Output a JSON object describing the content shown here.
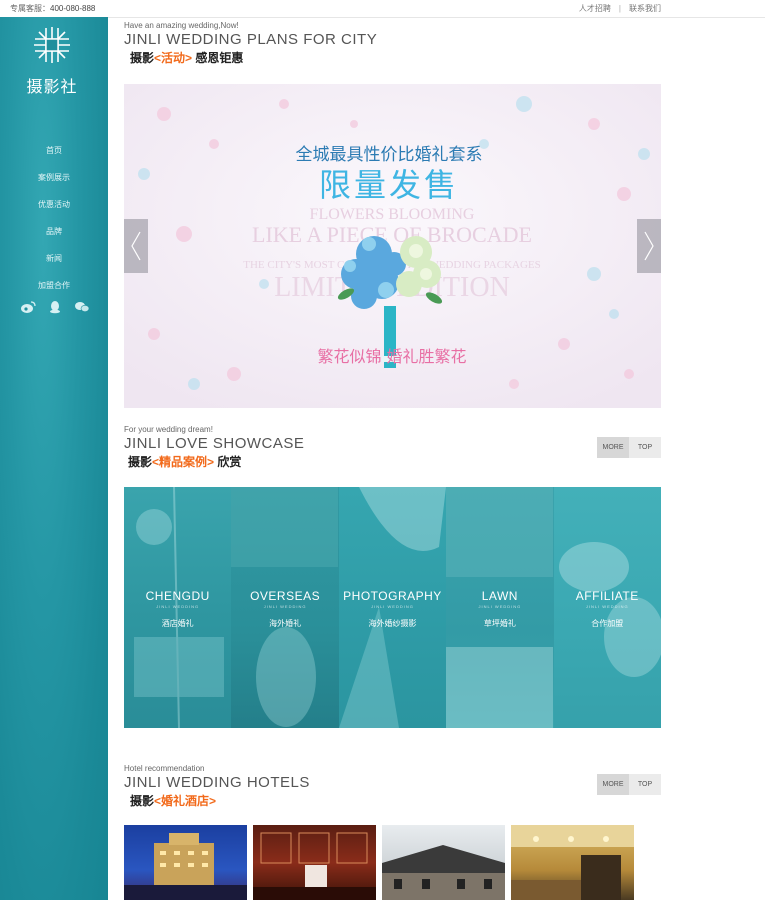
{
  "topbar": {
    "hotline_label": "专属客服：",
    "hotline_number": "400-080-888",
    "links": [
      "人才招聘",
      "联系我们"
    ]
  },
  "sidebar": {
    "logo_text": "摄影社",
    "nav": [
      "首页",
      "案例展示",
      "优惠活动",
      "品牌",
      "新闻",
      "加盟合作"
    ],
    "social_icons": [
      "weibo-icon",
      "qq-icon",
      "wechat-icon"
    ]
  },
  "section_plans": {
    "eyebrow": "Have an amazing wedding,Now!",
    "title": "JINLI WEDDING PLANS FOR CITY",
    "sub_prefix": "摄影",
    "sub_highlight": "<活动>",
    "sub_suffix": " 感恩钜惠"
  },
  "banner": {
    "headline": "全城最具性价比婚礼套系",
    "big": "限量发售",
    "en_line1": "FLOWERS BLOOMING",
    "en_line2": "LIKE A PIECE OF BROCADE",
    "en_line3": "THE CITY'S MOST COST-EFFECTIVE WEDDING PACKAGES",
    "en_line4": "LIMITED EDITION",
    "tagline": "繁花似锦 婚礼胜繁花"
  },
  "section_showcase": {
    "eyebrow": "For your wedding dream!",
    "title": "JINLI LOVE SHOWCASE",
    "sub_prefix": "摄影",
    "sub_highlight": "<精品案例>",
    "sub_suffix": " 欣赏",
    "more": "MORE",
    "top": "TOP",
    "cases": [
      {
        "name": "CHENGDU",
        "sub": "JINLI WEDDING",
        "cn": "酒店婚礼"
      },
      {
        "name": "OVERSEAS",
        "sub": "JINLI WEDDING",
        "cn": "海外婚礼"
      },
      {
        "name": "PHOTOGRAPHY",
        "sub": "JINLI WEDDING",
        "cn": "海外婚纱摄影"
      },
      {
        "name": "LAWN",
        "sub": "JINLI WEDDING",
        "cn": "草坪婚礼"
      },
      {
        "name": "AFFILIATE",
        "sub": "JINLI WEDDING",
        "cn": "合作加盟"
      }
    ]
  },
  "section_hotels": {
    "eyebrow": "Hotel recommendation",
    "title": "JINLI WEDDING HOTELS",
    "sub_prefix": "摄影",
    "sub_highlight": "<婚礼酒店>",
    "more": "MORE",
    "top": "TOP"
  },
  "colors": {
    "sidebar": "#1f8f9d",
    "accent": "#f26a1b",
    "teal_overlay": "#2aa3ae"
  }
}
